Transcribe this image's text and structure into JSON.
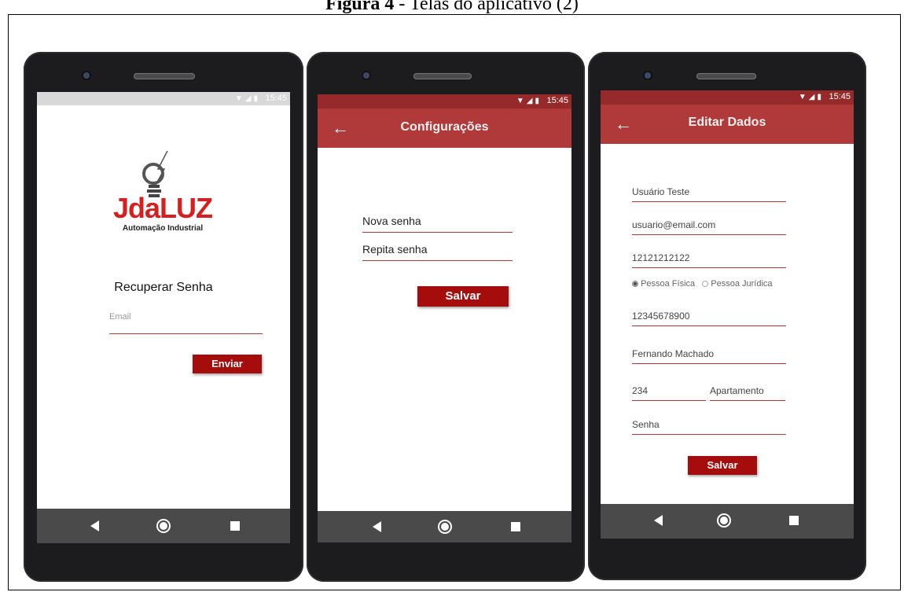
{
  "caption": {
    "prefix": "Figura 4",
    "rest": " - Telas do aplicativo (2)"
  },
  "colors": {
    "accent": "#b03a3a",
    "button": "#a50d0d",
    "phone": "#1c1c1e",
    "navbar": "#4a4a4a"
  },
  "screen1": {
    "time": "15:45",
    "logo": {
      "brand_left": "Jda",
      "brand_right": "LUZ",
      "tagline": "Automação Industrial"
    },
    "heading": "Recuperar Senha",
    "email_placeholder": "Email",
    "send_label": "Enviar"
  },
  "screen2": {
    "time": "15:45",
    "title": "Configurações",
    "new_password": "Nova senha",
    "repeat_password": "Repita senha",
    "save_label": "Salvar"
  },
  "screen3": {
    "time": "15:45",
    "title": "Editar Dados",
    "name": "Usuário Teste",
    "email": "usuario@email.com",
    "phone": "12121212122",
    "radio_fisica": "Pessoa Física",
    "radio_juridica": "Pessoa Jurídica",
    "document": "12345678900",
    "street": "Fernando Machado",
    "number": "234",
    "complement": "Apartamento",
    "password": "Senha",
    "save_label": "Salvar"
  }
}
